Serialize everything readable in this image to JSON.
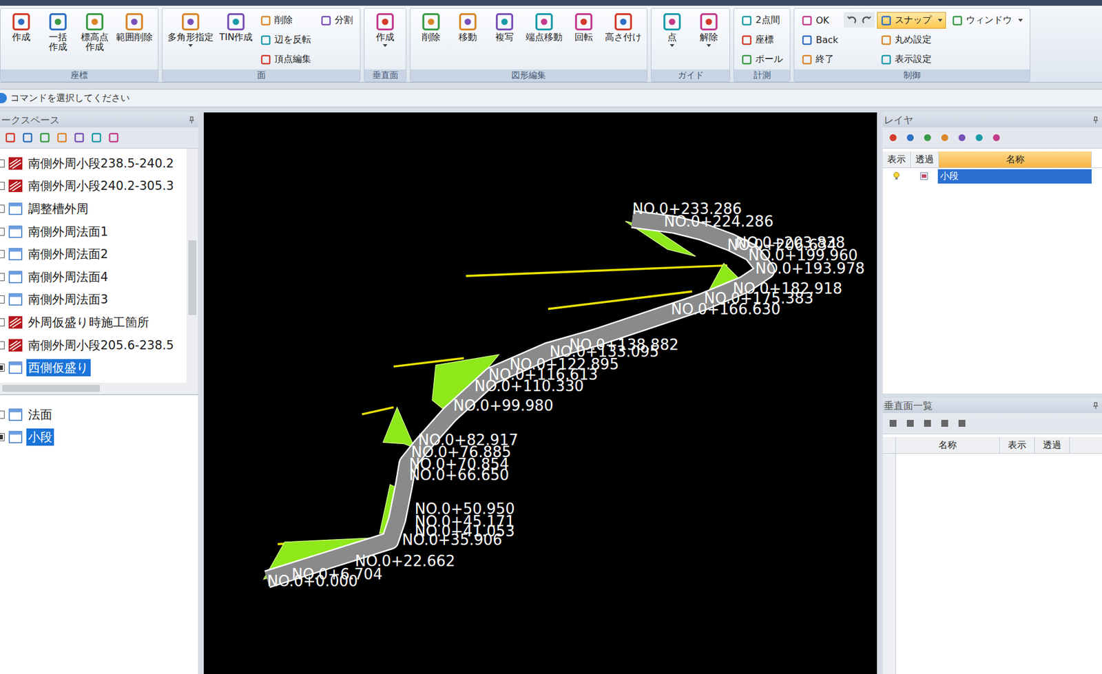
{
  "ribbon": {
    "groups": [
      {
        "label": "座標",
        "items": [
          {
            "kind": "large",
            "label": "作成",
            "dropdown": false
          },
          {
            "kind": "large",
            "label": "一括\n作成",
            "dropdown": false
          },
          {
            "kind": "large",
            "label": "標高点\n作成",
            "dropdown": false
          },
          {
            "kind": "large",
            "label": "範囲削除",
            "dropdown": false
          }
        ]
      },
      {
        "label": "面",
        "items": [
          {
            "kind": "large",
            "label": "多角形指定",
            "dropdown": true
          },
          {
            "kind": "large",
            "label": "TIN作成",
            "dropdown": false
          },
          {
            "kind": "stack",
            "buttons": [
              {
                "kind": "small",
                "label": "削除",
                "dropdown": false,
                "active": false
              },
              {
                "kind": "small",
                "label": "辺を反転",
                "dropdown": false,
                "active": false
              },
              {
                "kind": "small",
                "label": "頂点編集",
                "dropdown": false,
                "active": false
              }
            ]
          },
          {
            "kind": "stack",
            "buttons": [
              {
                "kind": "small",
                "label": "分割",
                "dropdown": false,
                "active": false
              }
            ]
          }
        ]
      },
      {
        "label": "垂直面",
        "items": [
          {
            "kind": "large",
            "label": "作成",
            "dropdown": true
          }
        ]
      },
      {
        "label": "図形編集",
        "items": [
          {
            "kind": "large",
            "label": "削除",
            "dropdown": false
          },
          {
            "kind": "large",
            "label": "移動",
            "dropdown": false
          },
          {
            "kind": "large",
            "label": "複写",
            "dropdown": false
          },
          {
            "kind": "large",
            "label": "端点移動",
            "dropdown": false
          },
          {
            "kind": "large",
            "label": "回転",
            "dropdown": false
          },
          {
            "kind": "large",
            "label": "高さ付け",
            "dropdown": false
          }
        ]
      },
      {
        "label": "ガイド",
        "items": [
          {
            "kind": "large",
            "label": "点",
            "dropdown": true
          },
          {
            "kind": "large",
            "label": "解除",
            "dropdown": true
          }
        ]
      },
      {
        "label": "計測",
        "items": [
          {
            "kind": "stack",
            "buttons": [
              {
                "kind": "small",
                "label": "2点間",
                "dropdown": false,
                "active": false
              },
              {
                "kind": "small",
                "label": "座標",
                "dropdown": false,
                "active": false
              },
              {
                "kind": "small",
                "label": "ポール",
                "dropdown": false,
                "active": false
              }
            ]
          }
        ]
      },
      {
        "label": "制御",
        "items": [
          {
            "kind": "stack",
            "buttons": [
              {
                "kind": "small",
                "label": "OK",
                "dropdown": false,
                "active": false
              },
              {
                "kind": "small",
                "label": "Back",
                "dropdown": false,
                "active": false
              },
              {
                "kind": "small",
                "label": "終了",
                "dropdown": false,
                "active": false
              }
            ]
          },
          {
            "kind": "stack",
            "buttons": [
              {
                "kind": "undo-redo",
                "label": "",
                "dropdown": false,
                "active": false
              }
            ]
          },
          {
            "kind": "stack",
            "buttons": [
              {
                "kind": "small",
                "label": "スナップ",
                "dropdown": true,
                "active": true
              },
              {
                "kind": "small",
                "label": "丸め設定",
                "dropdown": false,
                "active": false
              },
              {
                "kind": "small",
                "label": "表示設定",
                "dropdown": false,
                "active": false
              }
            ]
          },
          {
            "kind": "stack",
            "buttons": [
              {
                "kind": "small",
                "label": "ウィンドウ",
                "dropdown": true,
                "active": false
              }
            ]
          }
        ]
      }
    ]
  },
  "command_bar": {
    "text": "コマンドを選択してください"
  },
  "workspace": {
    "title": "ークスペース",
    "items": [
      {
        "label": "南側外周小段238.5-240.2",
        "kind": "surface",
        "checked": false,
        "selected": false
      },
      {
        "label": "南側外周小段240.2-305.3",
        "kind": "surface",
        "checked": false,
        "selected": false
      },
      {
        "label": "調整槽外周",
        "kind": "group",
        "checked": false,
        "selected": false
      },
      {
        "label": "南側外周法面1",
        "kind": "group",
        "checked": false,
        "selected": false
      },
      {
        "label": "南側外周法面2",
        "kind": "group",
        "checked": false,
        "selected": false
      },
      {
        "label": "南側外周法面4",
        "kind": "group",
        "checked": false,
        "selected": false
      },
      {
        "label": "南側外周法面3",
        "kind": "group",
        "checked": false,
        "selected": false
      },
      {
        "label": "外周仮盛り時施工箇所",
        "kind": "surface",
        "checked": false,
        "selected": false
      },
      {
        "label": "南側外周小段205.6-238.5",
        "kind": "surface",
        "checked": false,
        "selected": false
      },
      {
        "label": "西側仮盛り",
        "kind": "group",
        "checked": true,
        "selected": true
      }
    ],
    "lower_items": [
      {
        "label": "法面",
        "kind": "group",
        "checked": false,
        "selected": false
      },
      {
        "label": "小段",
        "kind": "group",
        "checked": true,
        "selected": true
      }
    ]
  },
  "canvas": {
    "station_labels": [
      "NO.0+233.286",
      "NO.0+224.286",
      "NO.0+206.634",
      "NO.0+203.838",
      "NO.0+199.960",
      "NO.0+193.978",
      "NO.0+182.918",
      "NO.0+175.383",
      "NO.0+166.630",
      "NO.0+138.882",
      "NO.0+133.095",
      "NO.0+122.895",
      "NO.0+116.613",
      "NO.0+110.330",
      "NO.0+99.980",
      "NO.0+82.917",
      "NO.0+76.885",
      "NO.0+70.854",
      "NO.0+66.650",
      "NO.0+50.950",
      "NO.0+45.171",
      "NO.0+41.053",
      "NO.0+35.906",
      "NO.0+22.662",
      "NO.0+6.704",
      "NO.0+0.000"
    ]
  },
  "layer_panel": {
    "title": "レイヤ",
    "columns": [
      "表示",
      "透過",
      "名称"
    ],
    "rows": [
      {
        "name": "小段",
        "visible": true,
        "selected": true
      }
    ]
  },
  "vertical_panel": {
    "title": "垂直面一覧",
    "columns": [
      "名称",
      "表示",
      "透過"
    ]
  }
}
